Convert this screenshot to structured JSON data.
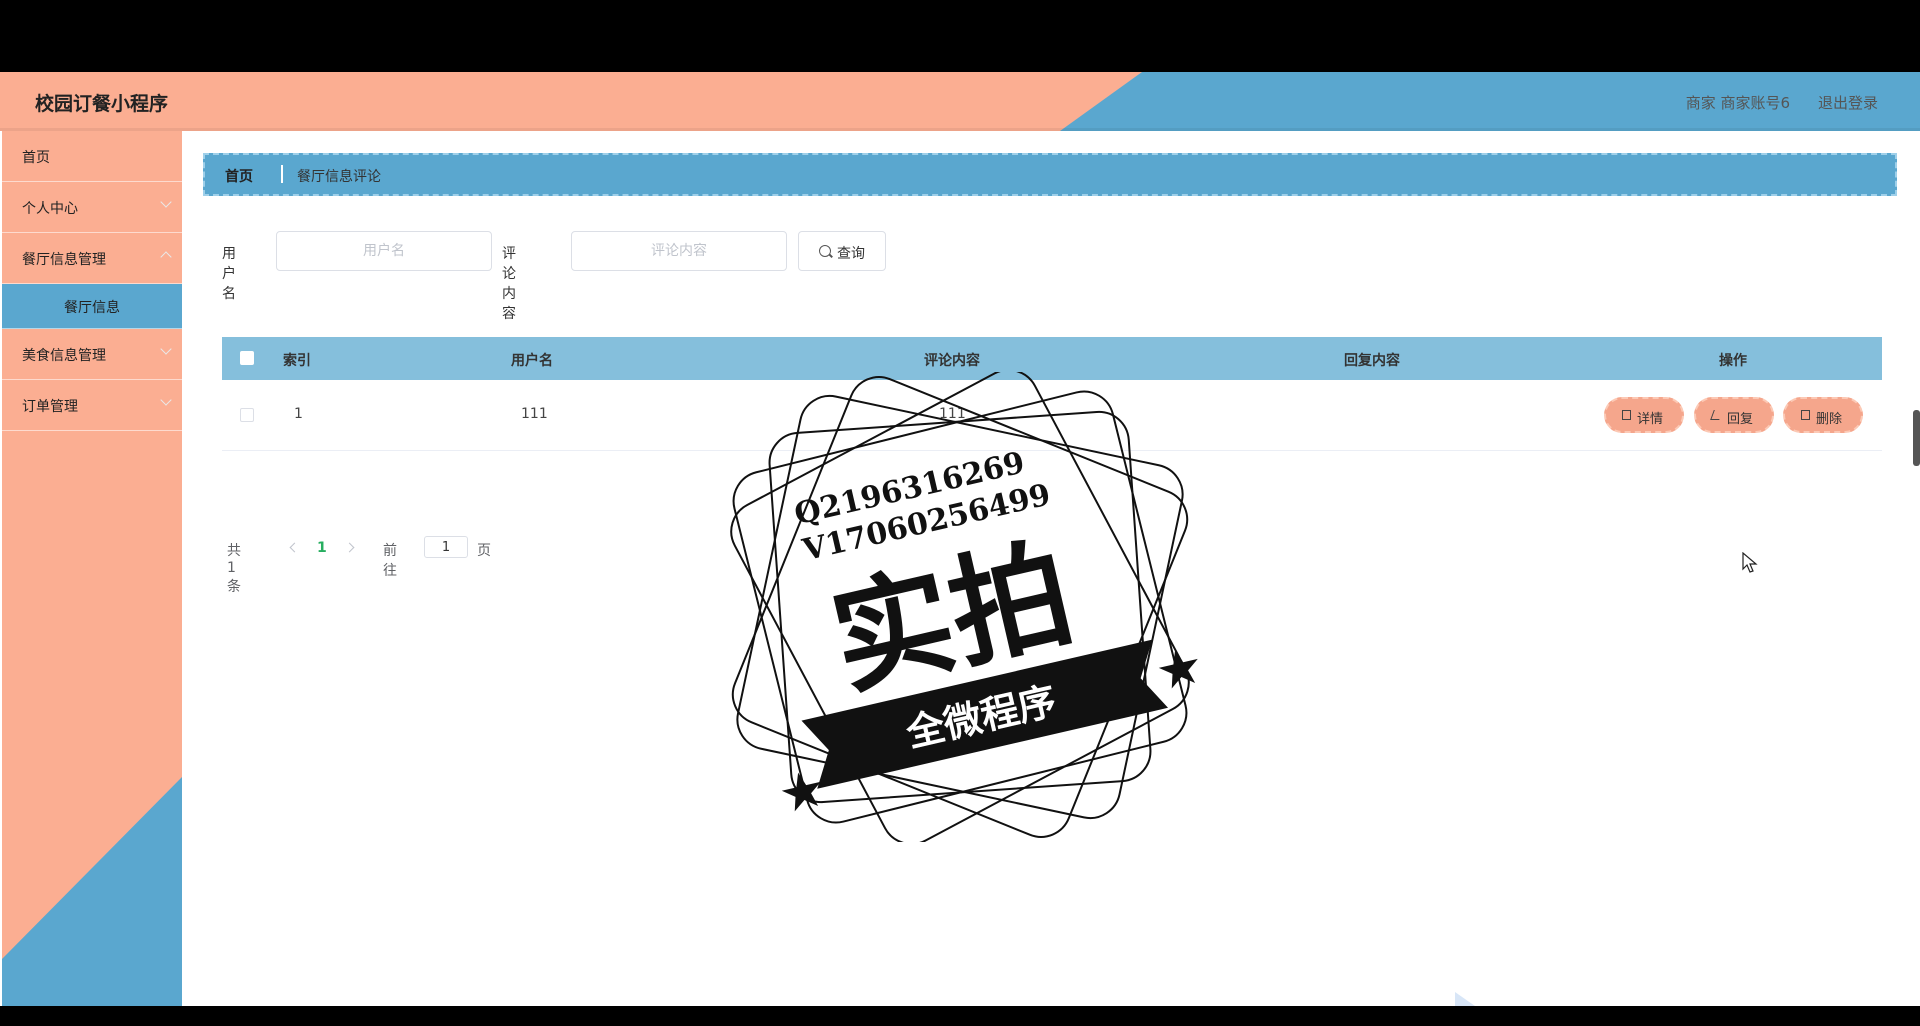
{
  "header": {
    "app_title": "校园订餐小程序",
    "user_info": "商家 商家账号6",
    "logout": "退出登录"
  },
  "sidebar": {
    "items": [
      {
        "label": "首页"
      },
      {
        "label": "个人中心"
      },
      {
        "label": "餐厅信息管理"
      },
      {
        "label": "餐厅信息"
      },
      {
        "label": "美食信息管理"
      },
      {
        "label": "订单管理"
      }
    ]
  },
  "breadcrumb": {
    "home": "首页",
    "current": "餐厅信息评论"
  },
  "search": {
    "username_label": "用户名",
    "username_placeholder": "用户名",
    "comment_label": "评论内容",
    "comment_placeholder": "评论内容",
    "button": "查询"
  },
  "table": {
    "headers": [
      "索引",
      "用户名",
      "评论内容",
      "回复内容",
      "操作"
    ],
    "rows": [
      {
        "index": "1",
        "username": "111",
        "comment": "111",
        "reply": ""
      }
    ],
    "actions": {
      "detail": "详情",
      "reply": "回复",
      "delete": "删除"
    }
  },
  "pagination": {
    "total": "共 1 条",
    "current": "1",
    "goto_label": "前往",
    "goto_value": "1",
    "page_suffix": "页"
  },
  "watermark": {
    "line1": "Q2196316269",
    "line2": "V17060256499",
    "main": "实拍",
    "banner": "全微程序"
  },
  "colors": {
    "salmon": "#fbae92",
    "blue": "#5aa7cf",
    "table_header": "#85bfdc",
    "action_button": "#f5a68c"
  }
}
